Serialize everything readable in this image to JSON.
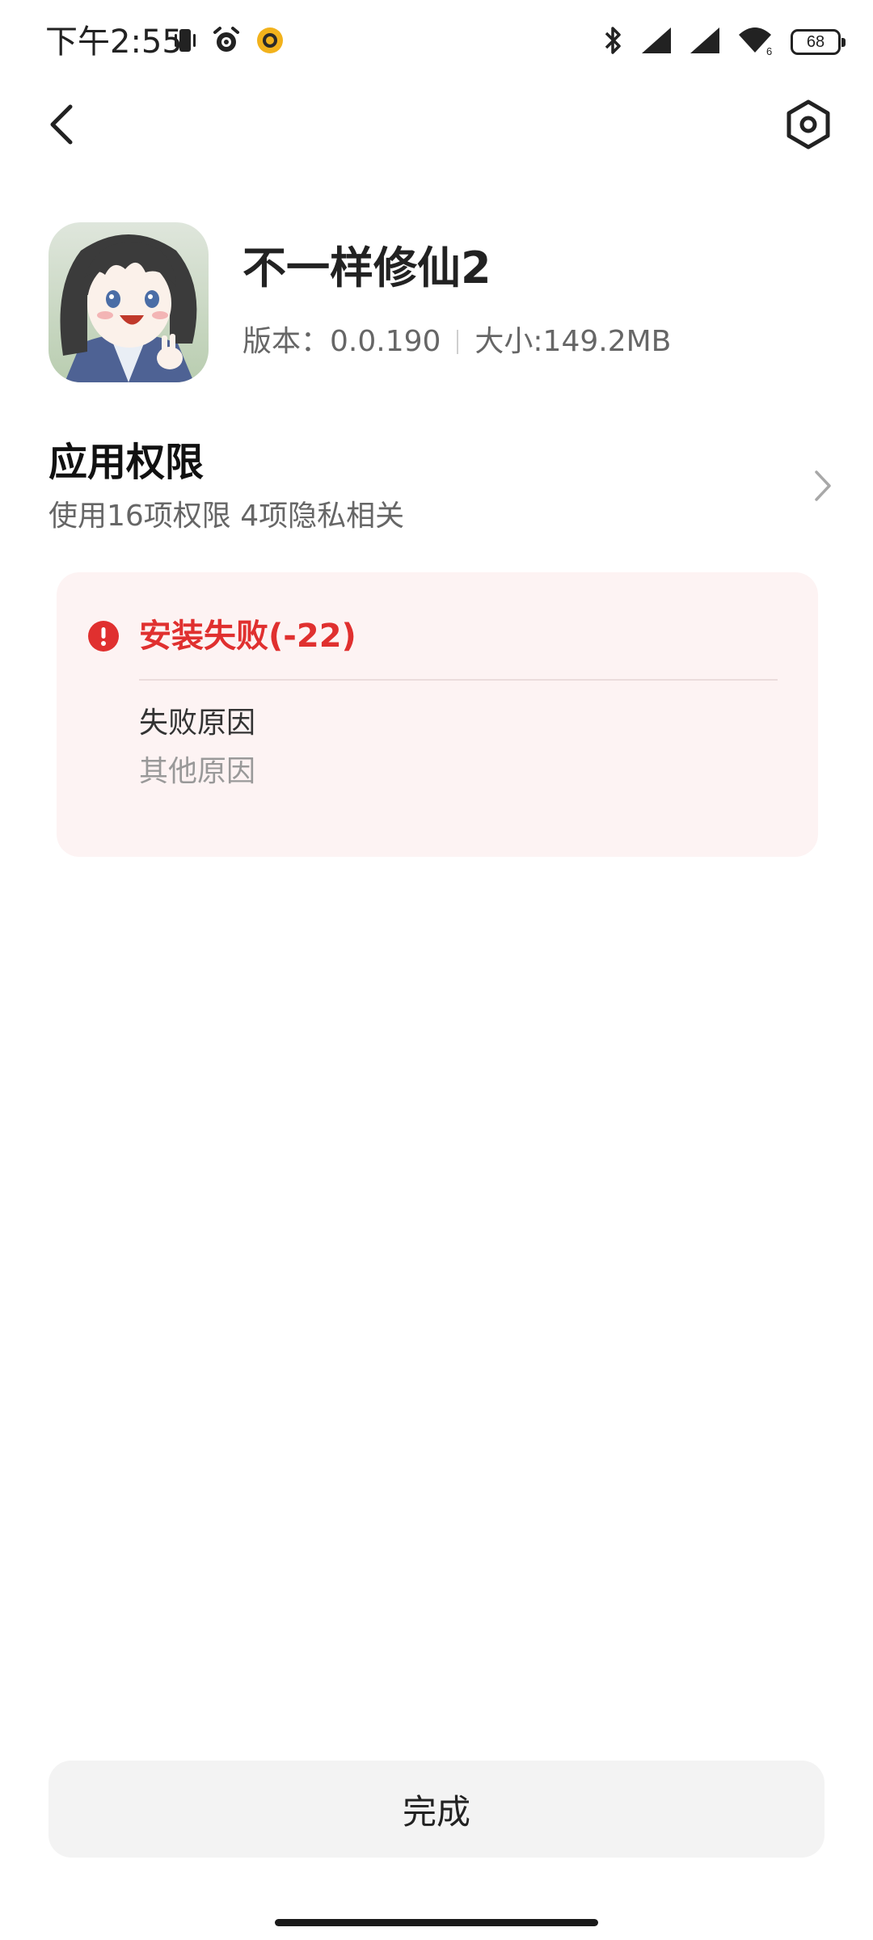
{
  "status_bar": {
    "time": "下午2:55",
    "battery_level": "68",
    "left_icons": [
      "vibrate-icon",
      "alarm-icon",
      "app-notification-icon"
    ],
    "right_icons": [
      "bluetooth-icon",
      "signal-icon",
      "signal-icon",
      "wifi-icon",
      "battery-icon"
    ]
  },
  "nav": {
    "back_icon": "chevron-left-icon",
    "settings_icon": "hexagon-settings-icon"
  },
  "app": {
    "name": "不一样修仙2",
    "version": "版本：0.0.190",
    "size": "大小:149.2MB",
    "icon": "app-icon-cartoon-character"
  },
  "permissions": {
    "title": "应用权限",
    "subtitle": "使用16项权限  4项隐私相关"
  },
  "install_error": {
    "title": "安装失败(-22)",
    "reason_label": "失败原因",
    "reason_value": "其他原因",
    "accent_color": "#e0302f",
    "card_color": "#fdf3f3"
  },
  "actions": {
    "done_label": "完成"
  }
}
